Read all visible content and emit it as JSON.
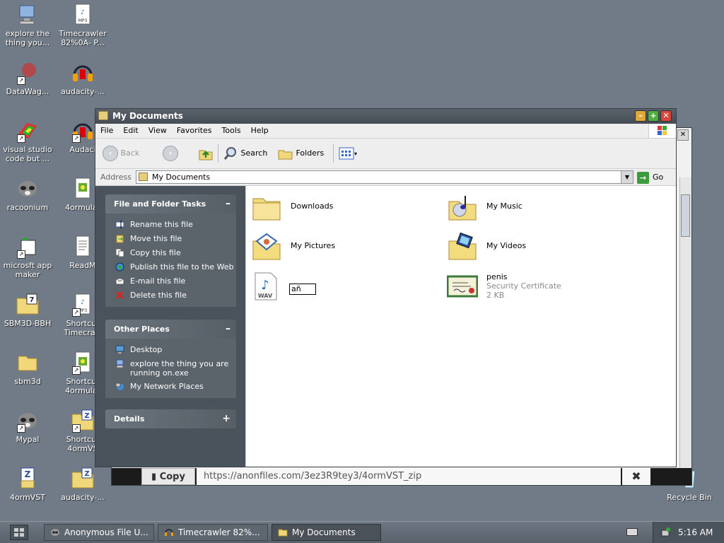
{
  "desktop": {
    "icons": [
      {
        "label": "explore the thing you..."
      },
      {
        "label": "Timecrawler 82%0A- P..."
      },
      {
        "label": "DataWag..."
      },
      {
        "label": "audacity-..."
      },
      {
        "label": "visual studio code but ..."
      },
      {
        "label": "Audaci"
      },
      {
        "label": "racoonium"
      },
      {
        "label": "4ormulat"
      },
      {
        "label": "microsft app maker"
      },
      {
        "label": "ReadM"
      },
      {
        "label": "SBM3D-BBH"
      },
      {
        "label": "Shortcut Timecraw"
      },
      {
        "label": "sbm3d"
      },
      {
        "label": "Shortcut 4ormulat"
      },
      {
        "label": "Mypal"
      },
      {
        "label": "Shortcut 4ormVS"
      },
      {
        "label": "4ormVST"
      },
      {
        "label": "audacity-..."
      },
      {
        "label": "Recycle Bin"
      }
    ],
    "icon_glyphs": {
      "mp3": "MP3",
      "wav": "WAV",
      "z": "Z",
      "seven": "7"
    }
  },
  "back_window": {
    "copy_label": "Copy",
    "url": "https://anonfiles.com/3ez3R9tey3/4ormVST_zip",
    "close": "✖",
    "close_small": "✕"
  },
  "window": {
    "title": "My Documents",
    "buttons": {
      "min": "–",
      "max": "+",
      "close": "✕"
    },
    "menu": [
      "File",
      "Edit",
      "View",
      "Favorites",
      "Tools",
      "Help"
    ],
    "toolbar": {
      "back": "Back",
      "search": "Search",
      "folders": "Folders"
    },
    "address": {
      "label": "Address",
      "value": "My Documents",
      "go": "Go"
    },
    "tasks": {
      "file_folder": {
        "title": "File and Folder Tasks",
        "toggle": "–",
        "items": [
          "Rename this file",
          "Move this file",
          "Copy this file",
          "Publish this file to the Web",
          "E-mail this file",
          "Delete this file"
        ]
      },
      "other_places": {
        "title": "Other Places",
        "toggle": "–",
        "items": [
          "Desktop",
          "explore the thing you are running on.exe",
          "My Network Places"
        ]
      },
      "details": {
        "title": "Details",
        "toggle": "+"
      }
    },
    "files": [
      {
        "name": "Downloads"
      },
      {
        "name": "My Music"
      },
      {
        "name": "My Pictures"
      },
      {
        "name": "My Videos"
      },
      {
        "name": "añ",
        "editing": true
      },
      {
        "name": "penis",
        "type": "Security Certificate",
        "size": "2 KB"
      }
    ]
  },
  "taskbar": {
    "tasks": [
      "Anonymous File U...",
      "Timecrawler 82%...",
      "My Documents"
    ],
    "clock": "5:16 AM"
  },
  "colors": {
    "desktop": "#707b87",
    "taskpane": "#4a535c",
    "titlebar": "#4b525a"
  }
}
